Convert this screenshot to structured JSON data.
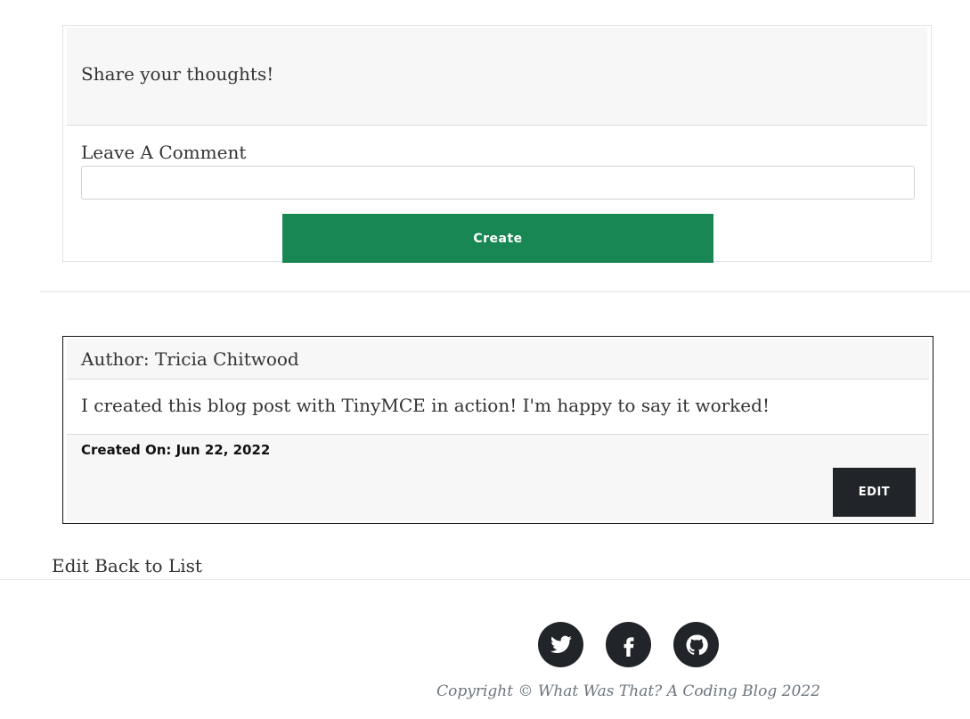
{
  "comment_section": {
    "header": "Share your thoughts!",
    "label": "Leave A Comment",
    "input_value": "",
    "input_placeholder": "",
    "create_label": "Create"
  },
  "post": {
    "author": "Author: Tricia Chitwood",
    "body": "I created this blog post with TinyMCE in action! I'm happy to say it worked!",
    "created_on": "Created On: Jun 22, 2022",
    "edit_label": "EDIT"
  },
  "links": {
    "edit": "Edit",
    "back_to_list": "Back to List"
  },
  "footer": {
    "social_icons": [
      "twitter-icon",
      "facebook-icon",
      "github-icon"
    ],
    "copyright": "Copyright © What Was That? A Coding Blog 2022"
  },
  "colors": {
    "create_button": "#198754",
    "dark_button": "#212529"
  }
}
